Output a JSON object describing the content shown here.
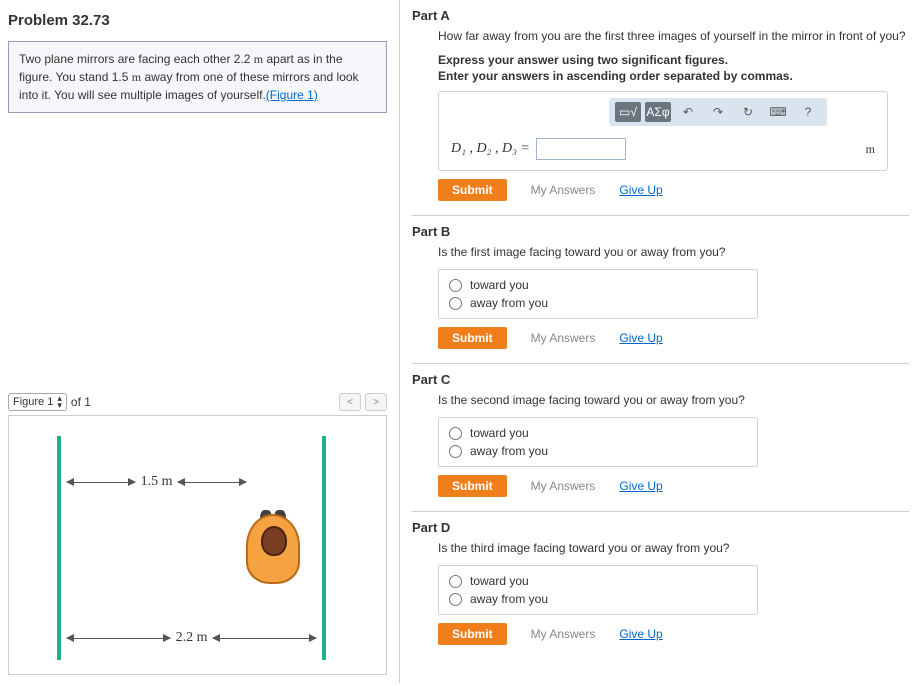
{
  "problem": {
    "title": "Problem 32.73",
    "description_pre": "Two plane mirrors are facing each other 2.2 ",
    "dist_unit_1": "m",
    "description_mid": " apart as in the figure. You stand 1.5 ",
    "dist_unit_2": "m",
    "description_post": " away from one of these mirrors and look into it. You will see multiple images of yourself.",
    "figure_link": "(Figure 1)"
  },
  "figure_nav": {
    "selected": "Figure 1",
    "of_text": "of 1"
  },
  "figure": {
    "top_dim": "1.5 m",
    "bottom_dim": "2.2 m"
  },
  "parts": {
    "a": {
      "label": "Part A",
      "question": "How far away from you are the first three images of yourself in the mirror in front of you?",
      "hint1": "Express your answer using two significant figures.",
      "hint2": "Enter your answers in ascending order separated by commas.",
      "vars": "D₁ , D₂ , D₃  =",
      "unit": "m"
    },
    "b": {
      "label": "Part B",
      "question": "Is the first image facing toward you or away from you?",
      "opt1": "toward you",
      "opt2": "away from you"
    },
    "c": {
      "label": "Part C",
      "question": "Is the second image facing toward you or away from you?",
      "opt1": "toward you",
      "opt2": "away from you"
    },
    "d": {
      "label": "Part D",
      "question": "Is the third image facing toward you or away from you?",
      "opt1": "toward you",
      "opt2": "away from you"
    }
  },
  "toolbar": {
    "sqrt": "√",
    "greek": "ΑΣφ",
    "undo": "↶",
    "redo": "↷",
    "reset": "↻",
    "keyboard": "⌨",
    "help": "?"
  },
  "actions": {
    "submit": "Submit",
    "my_answers": "My Answers",
    "give_up": "Give Up"
  }
}
